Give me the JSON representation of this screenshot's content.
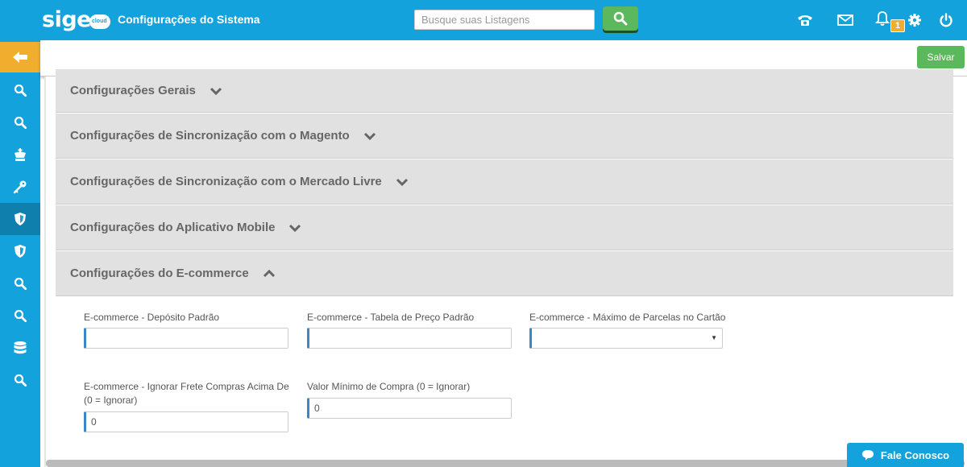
{
  "header": {
    "logo_text": "sige",
    "logo_sub": "cloud",
    "page_title": "Configurações do Sistema",
    "search_placeholder": "Busque suas Listagens",
    "notification_count": "1"
  },
  "colors": {
    "brand": "#14a2dc",
    "success": "#5cb85c",
    "warning": "#f0ad2e",
    "section_bg": "#e1e1e1",
    "field_accent": "#3a87c8"
  },
  "sidebar": {
    "back_icon": "arrow-left-icon",
    "items": [
      {
        "icon": "search-icon"
      },
      {
        "icon": "search-icon"
      },
      {
        "icon": "chess-king-icon"
      },
      {
        "icon": "key-icon"
      },
      {
        "icon": "shield-icon",
        "active": true
      },
      {
        "icon": "shield-icon"
      },
      {
        "icon": "search-icon"
      },
      {
        "icon": "search-icon"
      },
      {
        "icon": "database-icon"
      },
      {
        "icon": "search-icon"
      }
    ]
  },
  "toolbar": {
    "save_label": "Salvar"
  },
  "sections": [
    {
      "label": "Configurações Gerais",
      "expanded": false
    },
    {
      "label": "Configurações de Sincronização com o Magento",
      "expanded": false
    },
    {
      "label": "Configurações de Sincronização com o Mercado Livre",
      "expanded": false
    },
    {
      "label": "Configurações do Aplicativo Mobile",
      "expanded": false
    },
    {
      "label": "Configurações do E-commerce",
      "expanded": true
    }
  ],
  "ecommerce": {
    "deposito_label": "E-commerce - Depósito Padrão",
    "deposito_value": "",
    "tabela_label": "E-commerce - Tabela de Preço Padrão",
    "tabela_value": "",
    "parcelas_label": "E-commerce - Máximo de Parcelas no Cartão",
    "parcelas_value": "",
    "frete_label_line1": "E-commerce - Ignorar Frete Compras Acima De",
    "frete_label_line2": "(0 = Ignorar)",
    "frete_value": "0",
    "minimo_label": "Valor Mínimo de Compra (0 = Ignorar)",
    "minimo_value": "0"
  },
  "footer": {
    "contact_label": "Fale Conosco"
  }
}
